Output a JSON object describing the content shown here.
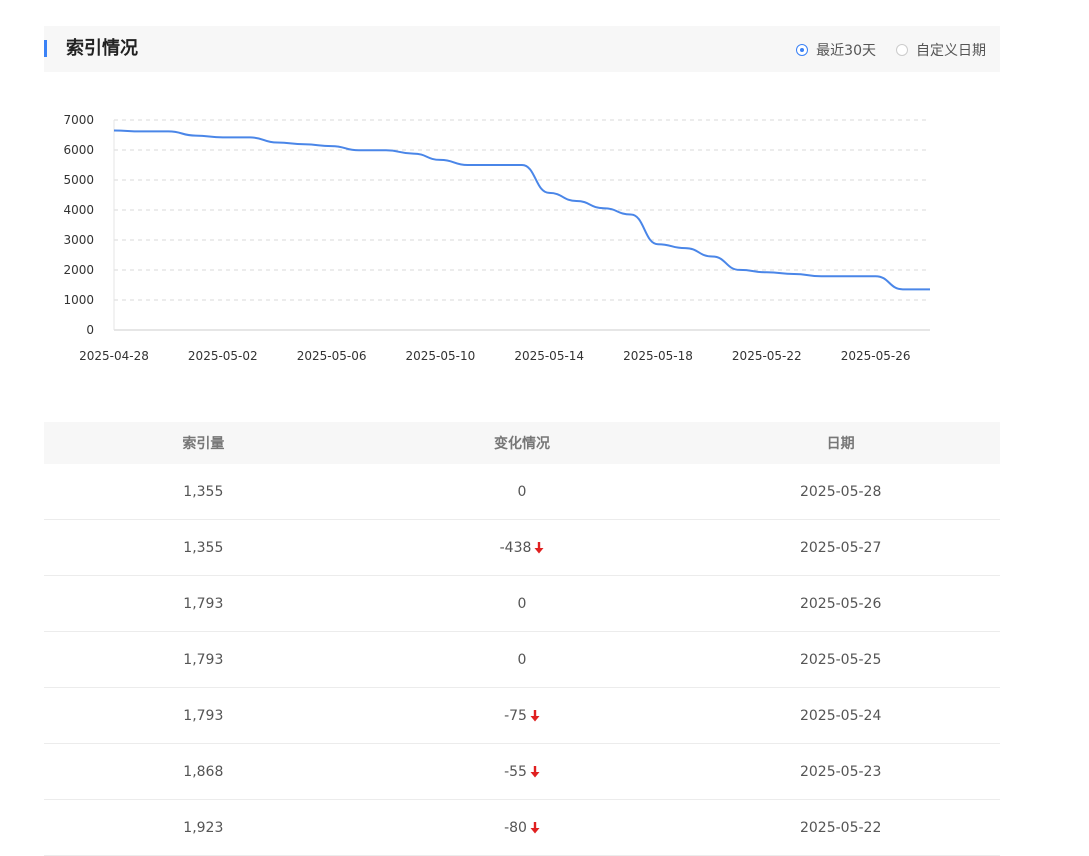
{
  "header": {
    "title": "索引情况",
    "radio_options": [
      {
        "label": "最近30天",
        "checked": true
      },
      {
        "label": "自定义日期",
        "checked": false
      }
    ]
  },
  "chart_data": {
    "type": "line",
    "x_ticks": [
      "2025-04-28",
      "2025-05-02",
      "2025-05-06",
      "2025-05-10",
      "2025-05-14",
      "2025-05-18",
      "2025-05-22",
      "2025-05-26"
    ],
    "y_ticks": [
      0,
      1000,
      2000,
      3000,
      4000,
      5000,
      6000,
      7000
    ],
    "ylim": [
      0,
      7000
    ],
    "grid": true,
    "line_color": "#4a86e8",
    "series": [
      {
        "dates": [
          "2025-04-28",
          "2025-04-29",
          "2025-04-30",
          "2025-05-01",
          "2025-05-02",
          "2025-05-03",
          "2025-05-04",
          "2025-05-05",
          "2025-05-06",
          "2025-05-07",
          "2025-05-08",
          "2025-05-09",
          "2025-05-10",
          "2025-05-11",
          "2025-05-12",
          "2025-05-13",
          "2025-05-14",
          "2025-05-15",
          "2025-05-16",
          "2025-05-17",
          "2025-05-18",
          "2025-05-19",
          "2025-05-20",
          "2025-05-21",
          "2025-05-22",
          "2025-05-23",
          "2025-05-24",
          "2025-05-25",
          "2025-05-26",
          "2025-05-27",
          "2025-05-28"
        ],
        "values": [
          6650,
          6620,
          6620,
          6480,
          6420,
          6420,
          6250,
          6190,
          6130,
          5990,
          5990,
          5880,
          5670,
          5500,
          5500,
          5500,
          4570,
          4300,
          4060,
          3850,
          2860,
          2730,
          2450,
          2003,
          1923,
          1868,
          1793,
          1793,
          1793,
          1355,
          1355
        ]
      }
    ]
  },
  "table": {
    "headers": [
      "索引量",
      "变化情况",
      "日期"
    ],
    "rows": [
      {
        "count": "1,355",
        "change": "0",
        "down": false,
        "date": "2025-05-28"
      },
      {
        "count": "1,355",
        "change": "-438",
        "down": true,
        "date": "2025-05-27"
      },
      {
        "count": "1,793",
        "change": "0",
        "down": false,
        "date": "2025-05-26"
      },
      {
        "count": "1,793",
        "change": "0",
        "down": false,
        "date": "2025-05-25"
      },
      {
        "count": "1,793",
        "change": "-75",
        "down": true,
        "date": "2025-05-24"
      },
      {
        "count": "1,868",
        "change": "-55",
        "down": true,
        "date": "2025-05-23"
      },
      {
        "count": "1,923",
        "change": "-80",
        "down": true,
        "date": "2025-05-22"
      }
    ]
  }
}
